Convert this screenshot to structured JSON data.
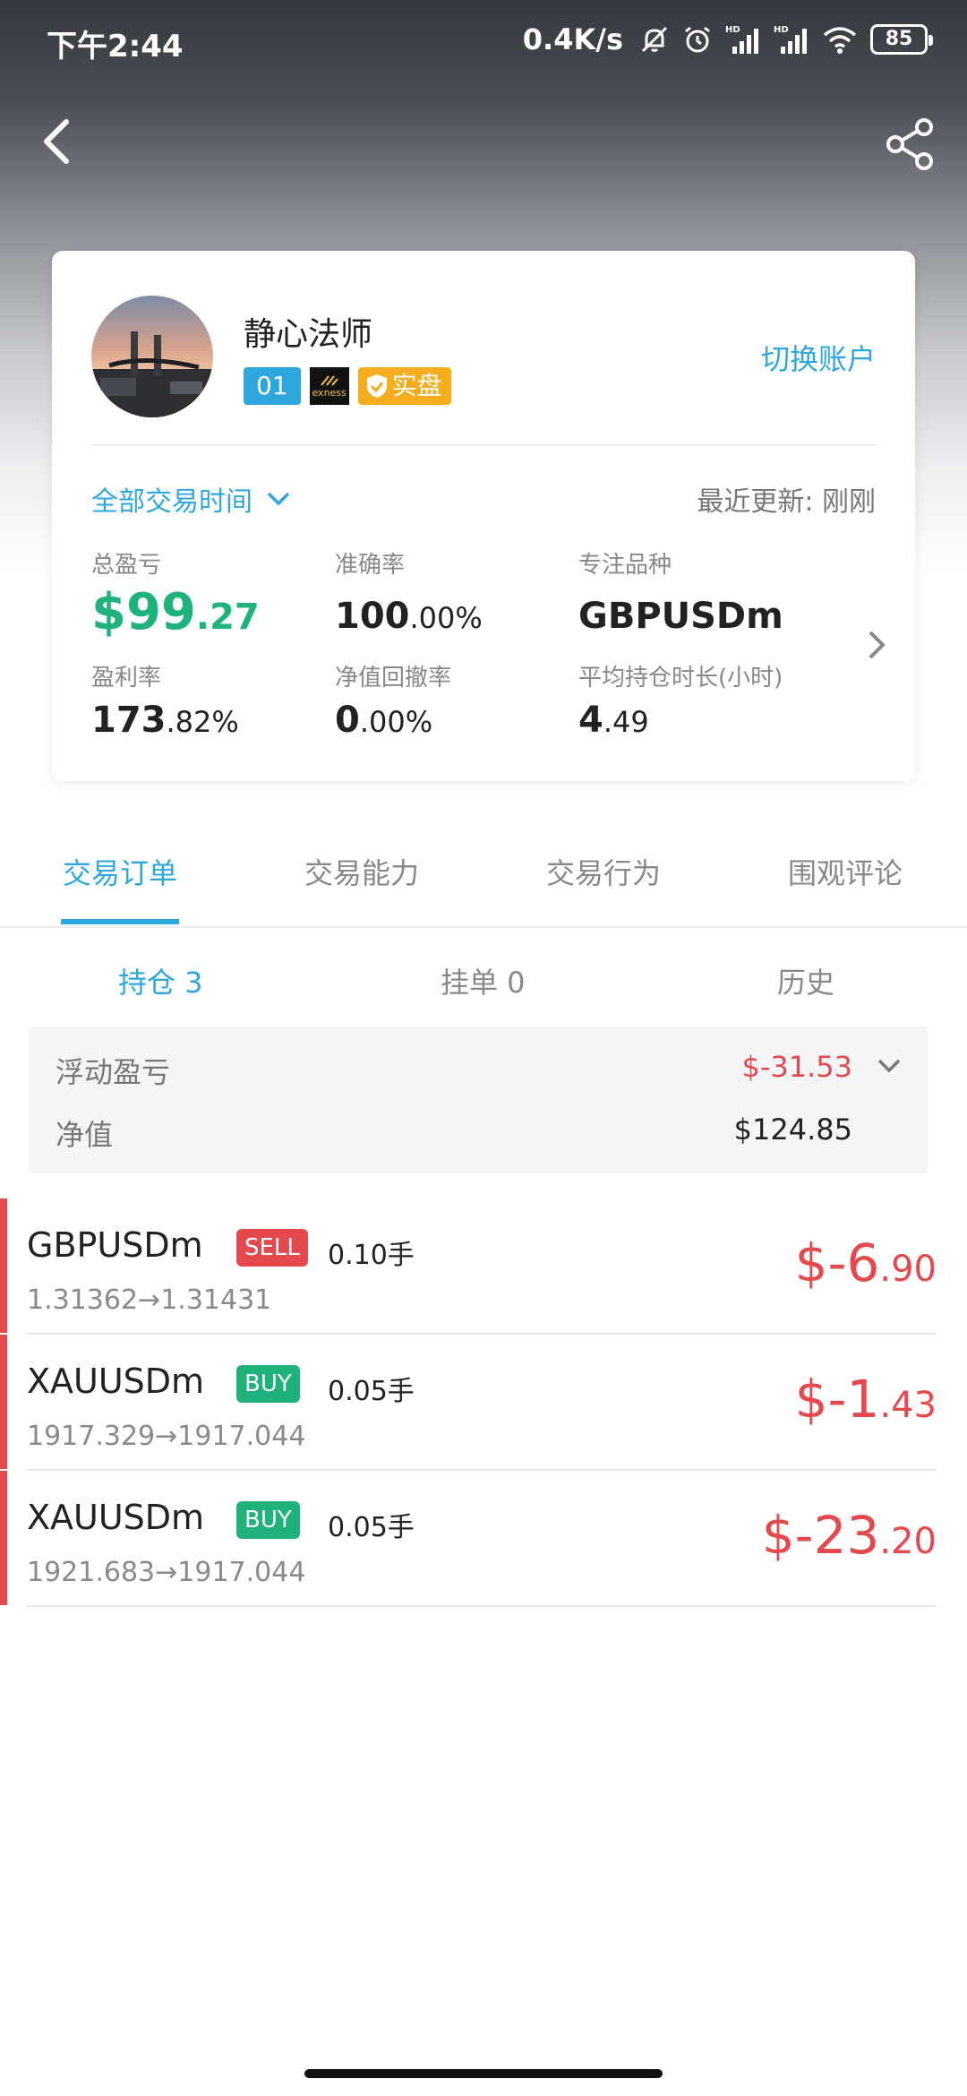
{
  "status_bar": {
    "time": "下午2:44",
    "net_speed": "0.4K/s",
    "battery": "85",
    "icons": [
      "mute-icon",
      "alarm-icon",
      "signal-hd-icon",
      "signal-hd-icon",
      "wifi-icon",
      "battery-icon"
    ]
  },
  "header": {
    "back_icon": "chevron-left-icon",
    "share_icon": "share-icon"
  },
  "profile": {
    "name": "静心法师",
    "badge_number": "01",
    "broker_logo_text": "exness",
    "account_type": "实盘",
    "switch_account_label": "切换账户"
  },
  "filter": {
    "time_range_label": "全部交易时间",
    "last_update_label": "最近更新: 刚刚"
  },
  "stats": {
    "total_pl_label": "总盈亏",
    "total_pl_main": "$99",
    "total_pl_decimal": ".27",
    "accuracy_label": "准确率",
    "accuracy_main": "100",
    "accuracy_decimal": ".00%",
    "focus_symbol_label": "专注品种",
    "focus_symbol_value": "GBPUSDm",
    "profit_rate_label": "盈利率",
    "profit_rate_main": "173",
    "profit_rate_decimal": ".82%",
    "drawdown_label": "净值回撤率",
    "drawdown_main": "0",
    "drawdown_decimal": ".00%",
    "avg_hold_label": "平均持仓时长(小时)",
    "avg_hold_main": "4",
    "avg_hold_decimal": ".49"
  },
  "tabs": [
    "交易订单",
    "交易能力",
    "交易行为",
    "围观评论"
  ],
  "subtabs": [
    "持仓 3",
    "挂单 0",
    "历史"
  ],
  "summary": {
    "floating_pl_label": "浮动盈亏",
    "floating_pl_value": "$-31.53",
    "equity_label": "净值",
    "equity_value": "$124.85"
  },
  "orders": [
    {
      "symbol": "GBPUSDm",
      "side": "SELL",
      "lots": "0.10手",
      "prices": "1.31362→1.31431",
      "pl_main": "$-6",
      "pl_decimal": ".90"
    },
    {
      "symbol": "XAUUSDm",
      "side": "BUY",
      "lots": "0.05手",
      "prices": "1917.329→1917.044",
      "pl_main": "$-1",
      "pl_decimal": ".43"
    },
    {
      "symbol": "XAUUSDm",
      "side": "BUY",
      "lots": "0.05手",
      "prices": "1921.683→1917.044",
      "pl_main": "$-23",
      "pl_decimal": ".20"
    }
  ],
  "colors": {
    "accent": "#2ea7df",
    "profit_green": "#1fb27a",
    "loss_red": "#e5484d",
    "real_badge": "#f5ad1e"
  }
}
